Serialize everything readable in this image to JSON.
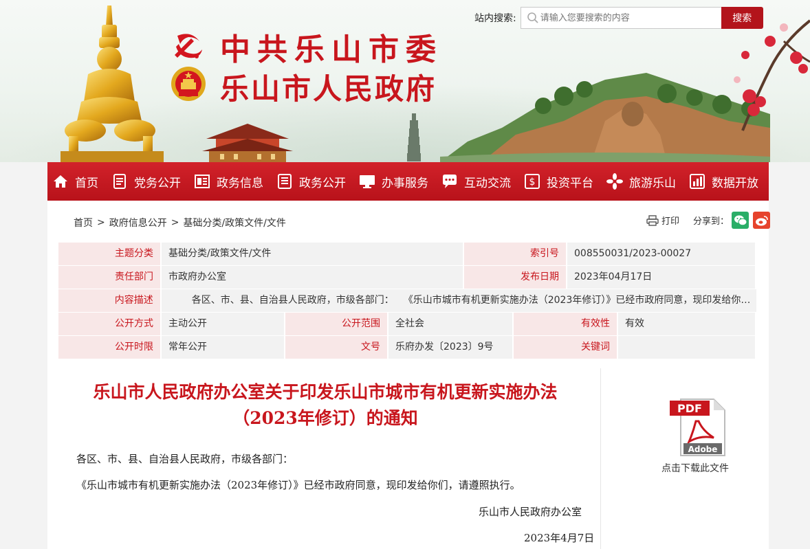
{
  "header": {
    "title_line1": "中共乐山市委",
    "title_line2": "乐山市人民政府",
    "search_label": "站内搜索:",
    "search_placeholder": "请输入您要搜索的内容",
    "search_button": "搜索"
  },
  "nav": [
    {
      "label": "首页",
      "icon": "home-icon"
    },
    {
      "label": "党务公开",
      "icon": "document-icon"
    },
    {
      "label": "政务信息",
      "icon": "newspaper-icon"
    },
    {
      "label": "政务公开",
      "icon": "list-icon"
    },
    {
      "label": "办事服务",
      "icon": "monitor-icon"
    },
    {
      "label": "互动交流",
      "icon": "chat-icon"
    },
    {
      "label": "投资平台",
      "icon": "investment-icon"
    },
    {
      "label": "旅游乐山",
      "icon": "flower-icon"
    },
    {
      "label": "数据开放",
      "icon": "bar-chart-icon"
    }
  ],
  "breadcrumb": [
    "首页",
    "政府信息公开",
    "基础分类/政策文件/文件"
  ],
  "breadcrumb_sep": ">",
  "tools": {
    "print": "打印",
    "share": "分享到："
  },
  "info": {
    "topic_key": "主题分类",
    "topic_val": "基础分类/政策文件/文件",
    "index_key": "索引号",
    "index_val": "008550031/2023-00027",
    "dept_key": "责任部门",
    "dept_val": "市政府办公室",
    "date_key": "发布日期",
    "date_val": "2023年04月17日",
    "desc_key": "内容描述",
    "desc_val": "各区、市、县、自治县人民政府，市级各部门：　　《乐山市城市有机更新实施办法（2023年修订）》已经市政府同意，现印发给你们，请遵照执行。",
    "mode_key": "公开方式",
    "mode_val": "主动公开",
    "scope_key": "公开范围",
    "scope_val": "全社会",
    "valid_key": "有效性",
    "valid_val": "有效",
    "term_key": "公开时限",
    "term_val": "常年公开",
    "docno_key": "文号",
    "docno_val": "乐府办发〔2023〕9号",
    "kw_key": "关键词",
    "kw_val": ""
  },
  "article": {
    "title_line1": "乐山市人民政府办公室关于印发乐山市城市有机更新实施办法",
    "title_line2": "（2023年修订）的通知",
    "p1": "各区、市、县、自治县人民政府，市级各部门：",
    "p2": "《乐山市城市有机更新实施办法（2023年修订）》已经市政府同意，现印发给你们，请遵照执行。",
    "sign": "乐山市人民政府办公室",
    "date": "2023年4月7日"
  },
  "download": {
    "label": "点击下载此文件",
    "pdf_text": "PDF",
    "adobe_text": "Adobe"
  },
  "colors": {
    "brand_red": "#c8161d",
    "nav_red": "#b8121a",
    "wechat": "#2aae67",
    "weibo": "#e6432c"
  }
}
